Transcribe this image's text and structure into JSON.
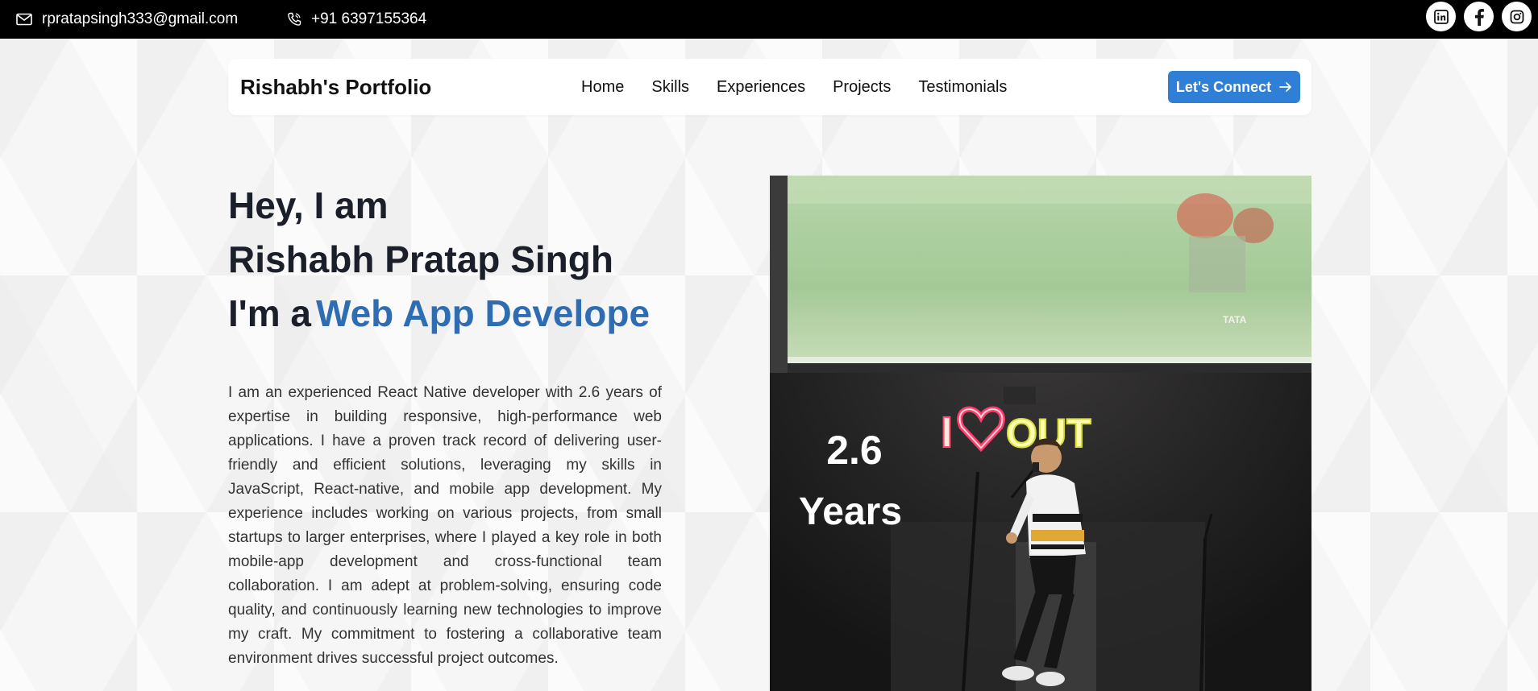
{
  "topbar": {
    "email": "rpratapsingh333@gmail.com",
    "phone": "+91 6397155364",
    "socials": [
      "linkedin-icon",
      "facebook-icon",
      "instagram-icon"
    ]
  },
  "nav": {
    "brand": "Rishabh's Portfolio",
    "links": [
      "Home",
      "Skills",
      "Experiences",
      "Projects",
      "Testimonials"
    ],
    "cta": "Let's Connect"
  },
  "hero": {
    "line1": "Hey, I am",
    "line2": "Rishabh Pratap Singh",
    "line3_prefix": "I'm a",
    "line3_accent": "Web App Develope",
    "bio": "I am an experienced React Native developer with 2.6 years of expertise in building responsive, high-performance web applications. I have a proven track record of delivering user-friendly and efficient solutions, leveraging my skills in JavaScript, React-native, and mobile app development. My experience includes working on various projects, from small startups to larger enterprises, where I played a key role in both mobile-app development and cross-functional team collaboration. I am adept at problem-solving, ensuring code quality, and continuously learning new technologies to improve my craft. My commitment to fostering a collaborative team environment drives successful project outcomes."
  },
  "photo": {
    "years_value": "2.6",
    "years_label": "Years",
    "neon_text": "OUT",
    "screen_logo": "TATA"
  },
  "colors": {
    "accent": "#2f6db3",
    "cta": "#2e7fd5",
    "topbar": "#000000"
  }
}
